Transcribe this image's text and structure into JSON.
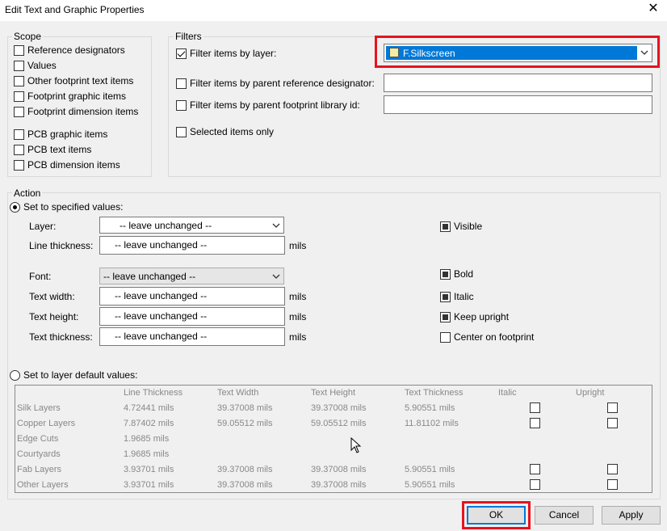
{
  "window": {
    "title": "Edit Text and Graphic Properties",
    "close_glyph": "✕"
  },
  "scope": {
    "label": "Scope",
    "items": [
      {
        "label": "Reference designators",
        "checked": false
      },
      {
        "label": "Values",
        "checked": false
      },
      {
        "label": "Other footprint text items",
        "checked": false
      },
      {
        "label": "Footprint graphic items",
        "checked": false
      },
      {
        "label": "Footprint dimension items",
        "checked": false
      },
      {
        "label": "PCB graphic items",
        "checked": false
      },
      {
        "label": "PCB text items",
        "checked": false
      },
      {
        "label": "PCB dimension items",
        "checked": false
      }
    ]
  },
  "filters": {
    "label": "Filters",
    "by_layer": {
      "label": "Filter items by layer:",
      "checked": true,
      "value": "F.Silkscreen",
      "swatch_color": "#f2eda1"
    },
    "by_parent_ref": {
      "label": "Filter items by parent reference designator:",
      "checked": false,
      "value": ""
    },
    "by_parent_lib": {
      "label": "Filter items by parent footprint library id:",
      "checked": false,
      "value": ""
    },
    "selected_only": {
      "label": "Selected items only",
      "checked": false
    }
  },
  "action": {
    "label": "Action",
    "set_specified": {
      "label": "Set to specified values:",
      "selected": true
    },
    "layer": {
      "label": "Layer:",
      "value": "-- leave unchanged --"
    },
    "line_thickness": {
      "label": "Line thickness:",
      "value": "-- leave unchanged --",
      "unit": "mils"
    },
    "font": {
      "label": "Font:",
      "value": "-- leave unchanged --"
    },
    "text_width": {
      "label": "Text width:",
      "value": "-- leave unchanged --",
      "unit": "mils"
    },
    "text_height": {
      "label": "Text height:",
      "value": "-- leave unchanged --",
      "unit": "mils"
    },
    "text_thickness": {
      "label": "Text thickness:",
      "value": "-- leave unchanged --",
      "unit": "mils"
    },
    "visible": {
      "label": "Visible",
      "state": "indeterminate"
    },
    "bold": {
      "label": "Bold",
      "state": "indeterminate"
    },
    "italic": {
      "label": "Italic",
      "state": "indeterminate"
    },
    "keep_upright": {
      "label": "Keep upright",
      "state": "indeterminate"
    },
    "center_on_footprint": {
      "label": "Center on footprint",
      "state": "unchecked"
    },
    "set_layer_default": {
      "label": "Set to layer default values:",
      "selected": false
    }
  },
  "defaults_grid": {
    "columns": [
      "",
      "Line Thickness",
      "Text Width",
      "Text Height",
      "Text Thickness",
      "Italic",
      "Upright"
    ],
    "rows": [
      {
        "name": "Silk Layers",
        "line": "4.72441 mils",
        "width": "39.37008 mils",
        "height": "39.37008 mils",
        "thickness": "5.90551 mils",
        "has_checks": true
      },
      {
        "name": "Copper Layers",
        "line": "7.87402 mils",
        "width": "59.05512 mils",
        "height": "59.05512 mils",
        "thickness": "11.81102 mils",
        "has_checks": true
      },
      {
        "name": "Edge Cuts",
        "line": "1.9685 mils",
        "width": "",
        "height": "",
        "thickness": "",
        "has_checks": false
      },
      {
        "name": "Courtyards",
        "line": "1.9685 mils",
        "width": "",
        "height": "",
        "thickness": "",
        "has_checks": false
      },
      {
        "name": "Fab Layers",
        "line": "3.93701 mils",
        "width": "39.37008 mils",
        "height": "39.37008 mils",
        "thickness": "5.90551 mils",
        "has_checks": true
      },
      {
        "name": "Other Layers",
        "line": "3.93701 mils",
        "width": "39.37008 mils",
        "height": "39.37008 mils",
        "thickness": "5.90551 mils",
        "has_checks": true
      }
    ]
  },
  "buttons": {
    "ok": "OK",
    "cancel": "Cancel",
    "apply": "Apply"
  },
  "colors": {
    "highlight_frame": "#e5141e",
    "selection": "#0078d7"
  }
}
